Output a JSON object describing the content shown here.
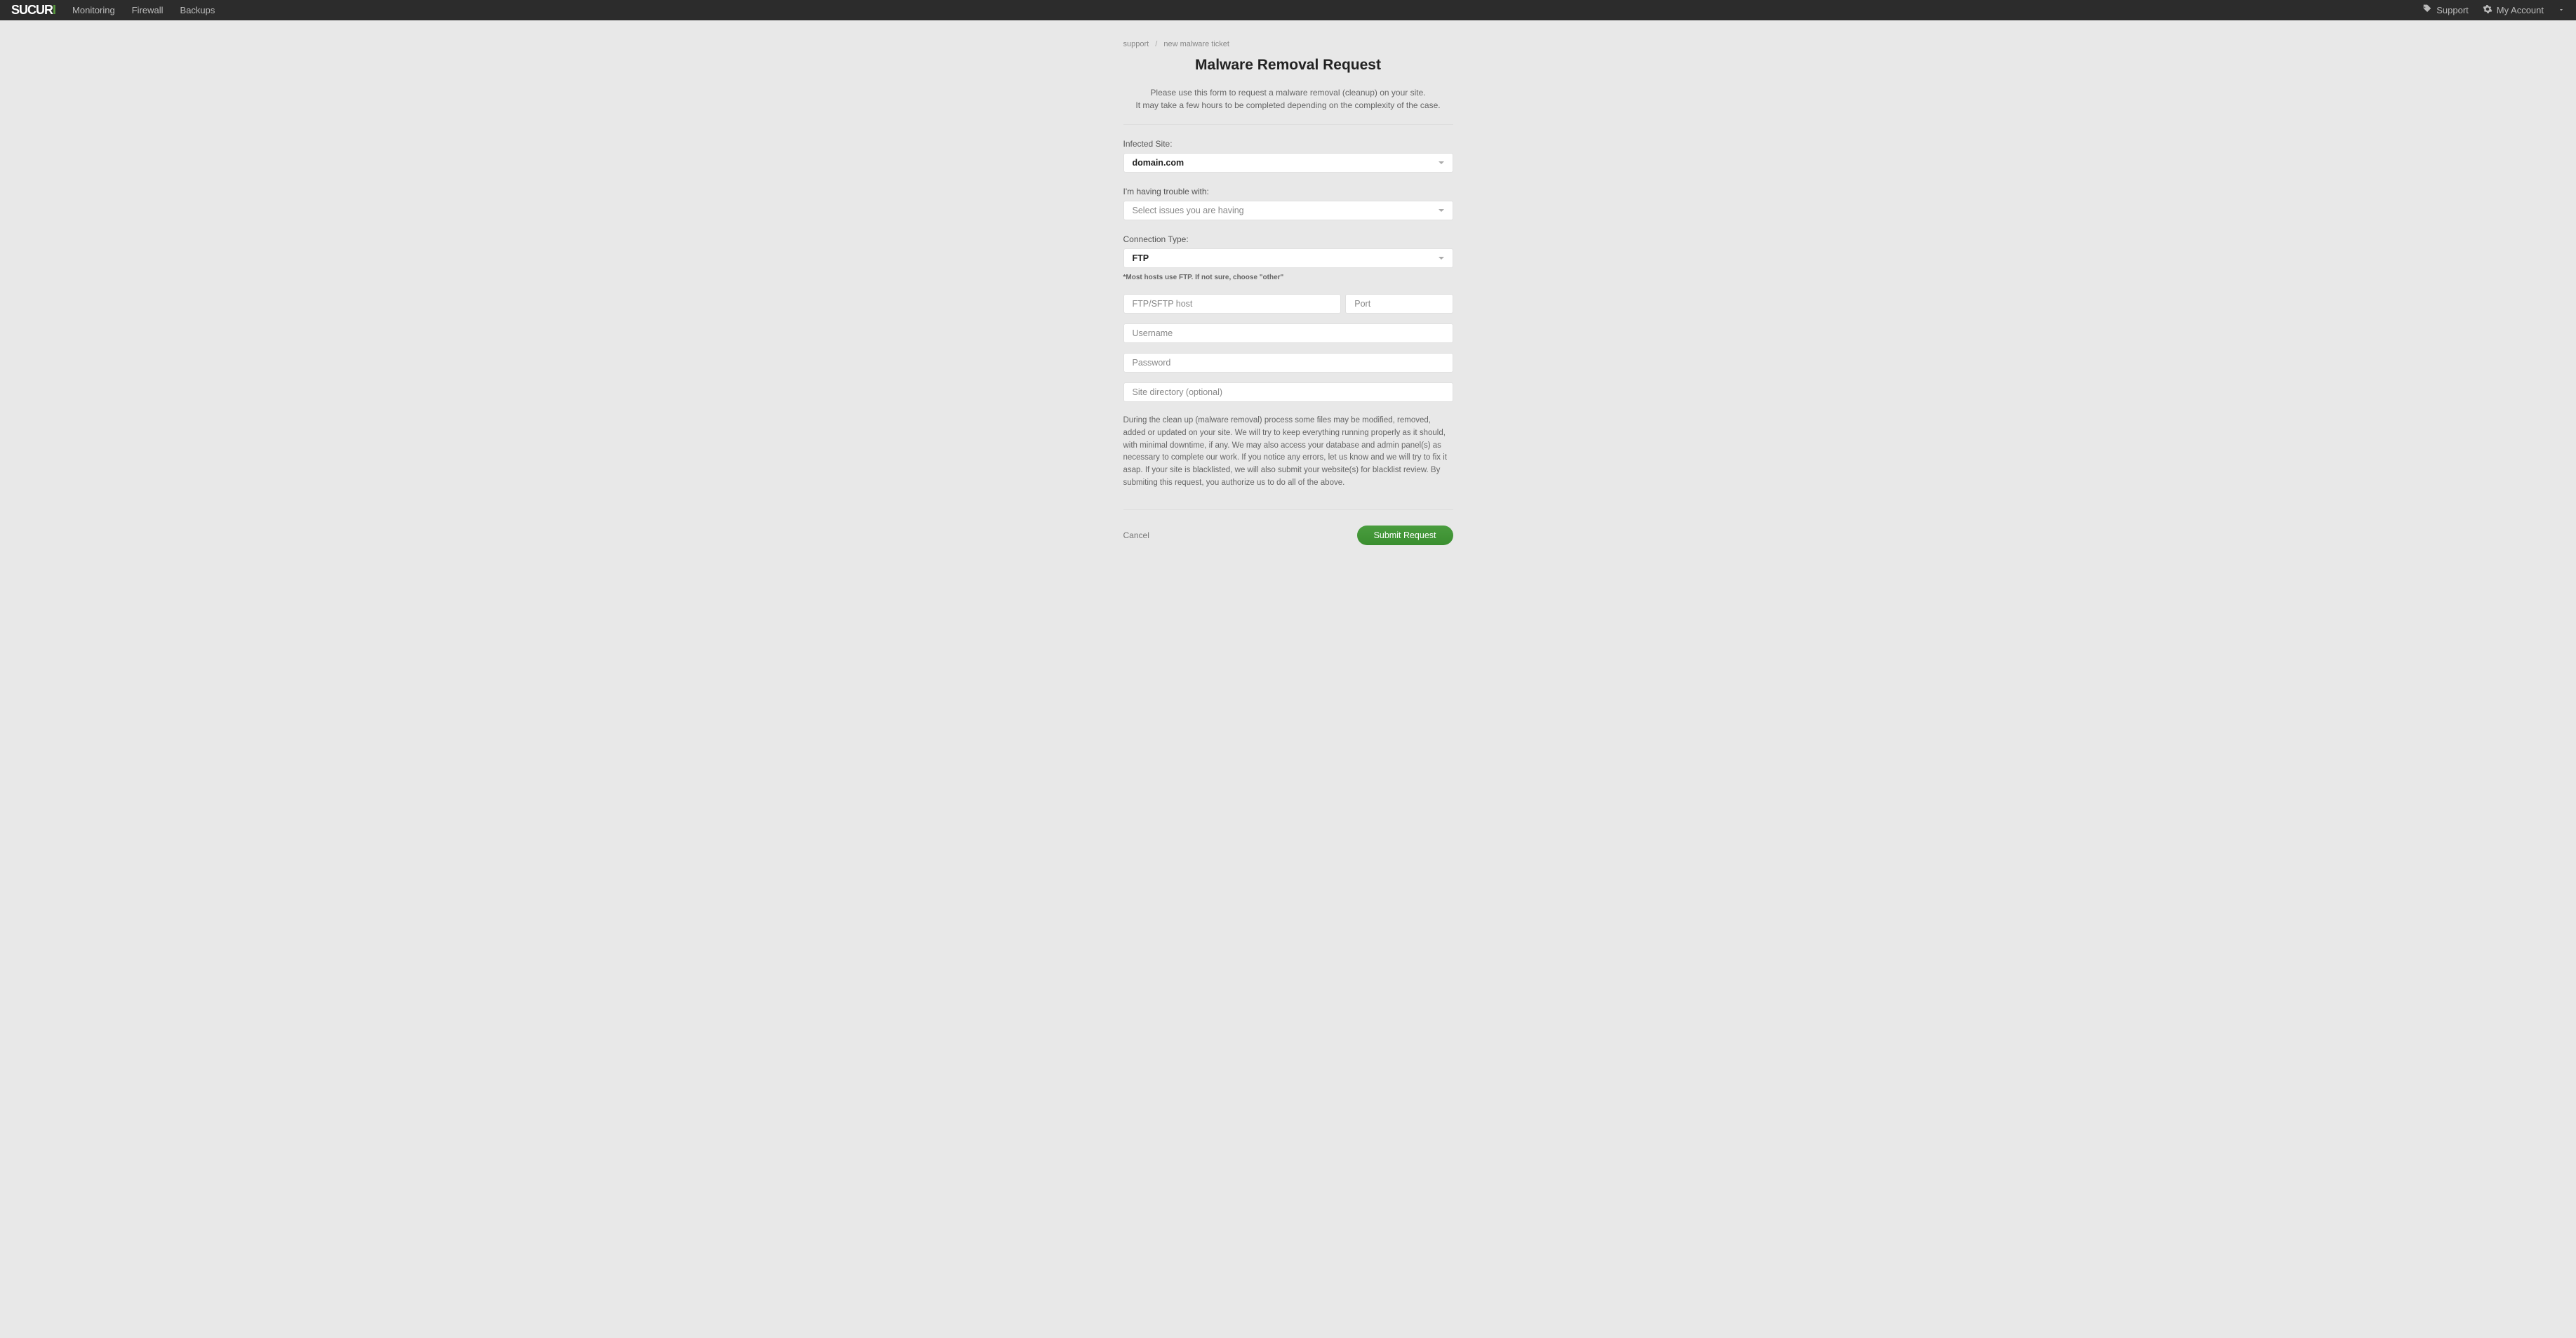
{
  "nav": {
    "monitoring": "Monitoring",
    "firewall": "Firewall",
    "backups": "Backups",
    "support": "Support",
    "account": "My Account"
  },
  "breadcrumb": {
    "support": "support",
    "current": "new malware ticket"
  },
  "page": {
    "title": "Malware Removal Request",
    "sub1": "Please use this form to request a malware removal (cleanup) on your site.",
    "sub2": "It may take a few hours to be completed depending on the complexity of the case."
  },
  "form": {
    "infected_label": "Infected Site:",
    "infected_value": "domain.com",
    "trouble_label": "I'm having trouble with:",
    "trouble_placeholder": "Select issues you are having",
    "conn_label": "Connection Type:",
    "conn_value": "FTP",
    "conn_hint": "*Most hosts use FTP. If not sure, choose \"other\"",
    "host_placeholder": "FTP/SFTP host",
    "port_placeholder": "Port",
    "user_placeholder": "Username",
    "pass_placeholder": "Password",
    "dir_placeholder": "Site directory (optional)",
    "disclaimer": "During the clean up (malware removal) process some files may be modified, removed, added or updated on your site. We will try to keep everything running properly as it should, with minimal downtime, if any. We may also access your database and admin panel(s) as necessary to complete our work. If you notice any errors, let us know and we will try to fix it asap. If your site is blacklisted, we will also submit your website(s) for blacklist review. By submiting this request, you authorize us to do all of the above.",
    "cancel": "Cancel",
    "submit": "Submit Request"
  }
}
